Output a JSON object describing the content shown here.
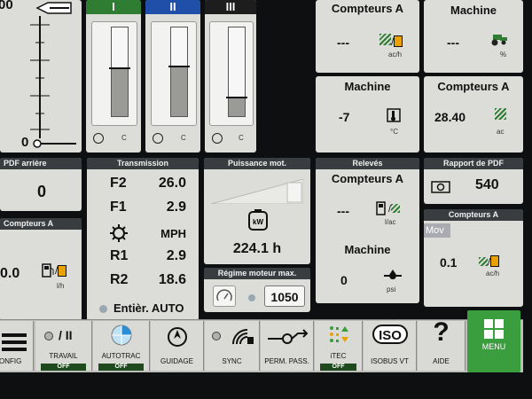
{
  "top_left": {
    "mark_00": "00",
    "mark_0": "0"
  },
  "gauges": [
    {
      "label": "I",
      "level": 0.53,
      "unit": "C"
    },
    {
      "label": "II",
      "level": 0.55,
      "unit": "C"
    },
    {
      "label": "III",
      "level": 0.2,
      "unit": "C"
    }
  ],
  "tile_ca_top": {
    "title": "Compteurs A",
    "value": "---",
    "unit": "ac/h"
  },
  "tile_machine_top": {
    "title": "Machine",
    "value": "---",
    "unit": "%"
  },
  "tile_machine_temp": {
    "title": "Machine",
    "value": "-7",
    "unit": "°C"
  },
  "tile_ca_area": {
    "title": "Compteurs A",
    "value": "28.40",
    "unit": "ac"
  },
  "pdf_arriere": {
    "title": "PDF arrière",
    "value": "0"
  },
  "compteurs_left": {
    "title": "Compteurs A",
    "value": "0.0",
    "unit": "l/h"
  },
  "transmission": {
    "title": "Transmission",
    "rows": [
      {
        "k": "F2",
        "v": "26.0"
      },
      {
        "k": "F1",
        "v": "2.9"
      },
      {
        "k": "",
        "v": "MPH"
      },
      {
        "k": "R1",
        "v": "2.9"
      },
      {
        "k": "R2",
        "v": "18.6"
      }
    ],
    "footer": "Entièr. AUTO"
  },
  "puissance": {
    "title": "Puissance mot.",
    "value": "224.1 h",
    "icon_text": "kW"
  },
  "regime": {
    "title": "Régime moteur max.",
    "value": "1050"
  },
  "releves": {
    "title": "Relevés",
    "ca_title": "Compteurs A",
    "ca_value": "---",
    "ca_unit": "l/ac",
    "machine_title": "Machine",
    "machine_value": "0",
    "machine_unit": "psi"
  },
  "rapport_pdf": {
    "title": "Rapport de PDF",
    "value": "540"
  },
  "compteurs_right": {
    "title": "Compteurs A",
    "mov": "Mov",
    "value": "0.1",
    "unit": "ac/h"
  },
  "bottom_bar": {
    "config": "ONFIG",
    "travail": "TRAVAIL",
    "travail_off": "OFF",
    "travail_glyph": "/ II",
    "autotrac": "AUTOTRAC",
    "autotrac_off": "OFF",
    "guidage": "GUIDAGE",
    "sync": "SYNC",
    "perm": "PERM. PASS.",
    "itec": "iTEC",
    "itec_off": "OFF",
    "iso_logo": "ISO",
    "isobus": "ISOBUS VT",
    "aide_glyph": "?",
    "aide": "AIDE",
    "menu": "MENU"
  },
  "colors": {
    "accent_green": "#3a9e3e",
    "header_dark": "#3a3d40",
    "panel": "#dcdcd8",
    "hourglass": "#e9a200"
  }
}
